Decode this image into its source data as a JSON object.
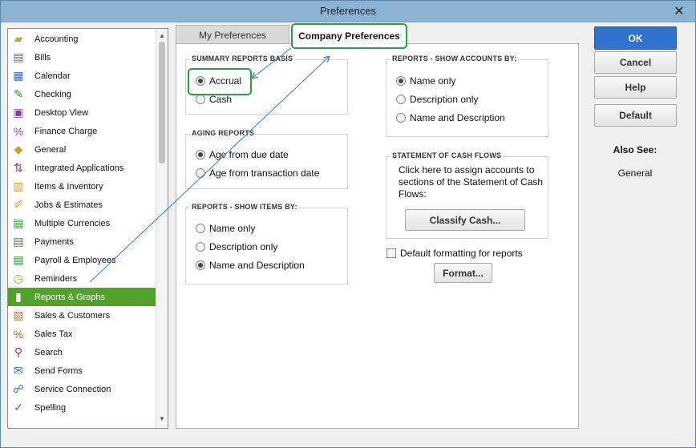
{
  "window": {
    "title": "Preferences",
    "close_glyph": "✕"
  },
  "sidebar": {
    "items": [
      {
        "label": "Accounting",
        "icon": "accounting-icon",
        "selected": false
      },
      {
        "label": "Bills",
        "icon": "bills-icon",
        "selected": false
      },
      {
        "label": "Calendar",
        "icon": "calendar-icon",
        "selected": false
      },
      {
        "label": "Checking",
        "icon": "checking-icon",
        "selected": false
      },
      {
        "label": "Desktop View",
        "icon": "desktop-view-icon",
        "selected": false
      },
      {
        "label": "Finance Charge",
        "icon": "finance-charge-icon",
        "selected": false
      },
      {
        "label": "General",
        "icon": "general-icon",
        "selected": false
      },
      {
        "label": "Integrated Applications",
        "icon": "integrated-applications-icon",
        "selected": false
      },
      {
        "label": "Items & Inventory",
        "icon": "items-inventory-icon",
        "selected": false
      },
      {
        "label": "Jobs & Estimates",
        "icon": "jobs-estimates-icon",
        "selected": false
      },
      {
        "label": "Multiple Currencies",
        "icon": "multiple-currencies-icon",
        "selected": false
      },
      {
        "label": "Payments",
        "icon": "payments-icon",
        "selected": false
      },
      {
        "label": "Payroll & Employees",
        "icon": "payroll-employees-icon",
        "selected": false
      },
      {
        "label": "Reminders",
        "icon": "reminders-icon",
        "selected": false
      },
      {
        "label": "Reports & Graphs",
        "icon": "reports-graphs-icon",
        "selected": true
      },
      {
        "label": "Sales & Customers",
        "icon": "sales-customers-icon",
        "selected": false
      },
      {
        "label": "Sales Tax",
        "icon": "sales-tax-icon",
        "selected": false
      },
      {
        "label": "Search",
        "icon": "search-icon",
        "selected": false
      },
      {
        "label": "Send Forms",
        "icon": "send-forms-icon",
        "selected": false
      },
      {
        "label": "Service Connection",
        "icon": "service-connection-icon",
        "selected": false
      },
      {
        "label": "Spelling",
        "icon": "spelling-icon",
        "selected": false
      }
    ],
    "selected_color": "#52a22a"
  },
  "tabs": {
    "my": "My Preferences",
    "company": "Company Preferences",
    "active": "company"
  },
  "summary_basis": {
    "title": "SUMMARY REPORTS BASIS",
    "options": [
      {
        "label": "Accrual",
        "checked": true
      },
      {
        "label": "Cash",
        "checked": false
      }
    ]
  },
  "aging": {
    "title": "AGING REPORTS",
    "options": [
      {
        "label": "Age from due date",
        "checked": true
      },
      {
        "label": "Age from transaction date",
        "checked": false
      }
    ]
  },
  "show_items": {
    "title": "REPORTS - SHOW ITEMS BY:",
    "options": [
      {
        "label": "Name only",
        "checked": false
      },
      {
        "label": "Description only",
        "checked": false
      },
      {
        "label": "Name and Description",
        "checked": true
      }
    ]
  },
  "show_accounts": {
    "title": "REPORTS -  SHOW ACCOUNTS BY:",
    "options": [
      {
        "label": "Name only",
        "checked": true
      },
      {
        "label": "Description only",
        "checked": false
      },
      {
        "label": "Name and Description",
        "checked": false
      }
    ]
  },
  "cash_flows": {
    "title": "STATEMENT OF CASH FLOWS",
    "text": "Click here to assign accounts to sections of the Statement of Cash Flows:",
    "button": "Classify Cash..."
  },
  "default_formatting": {
    "label": "Default formatting for reports",
    "checked": false,
    "button": "Format..."
  },
  "buttons": {
    "ok": "OK",
    "cancel": "Cancel",
    "help": "Help",
    "default": "Default"
  },
  "also_see": {
    "title": "Also See:",
    "items": [
      "General"
    ]
  },
  "colors": {
    "highlight_green": "#23a33a",
    "ok_blue": "#2f73cf",
    "arrow_blue": "#3a7bd5"
  }
}
